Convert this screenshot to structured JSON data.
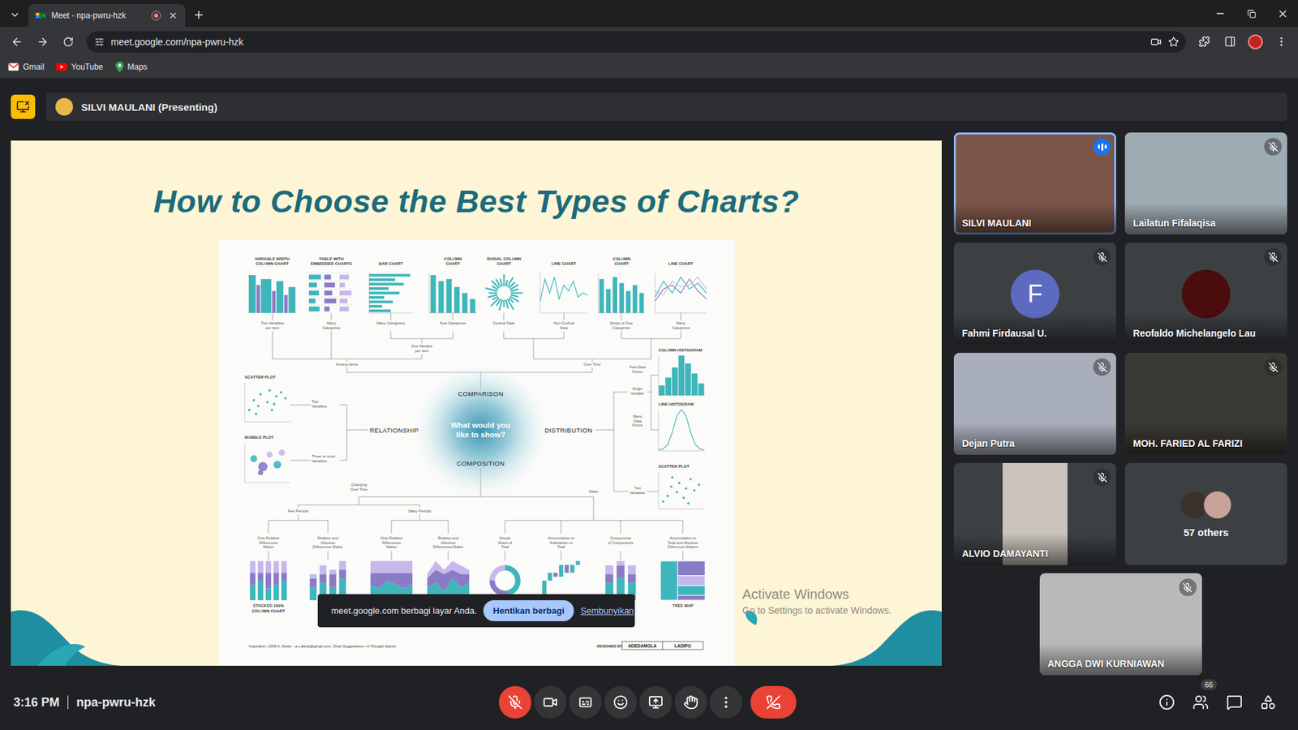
{
  "browser": {
    "tab": {
      "title": "Meet - npa-pwru-hzk",
      "selected": true,
      "recording": true
    },
    "address": "meet.google.com/npa-pwru-hzk",
    "bookmarks": [
      {
        "label": "Gmail",
        "kind": "mail",
        "color": "#ea4335"
      },
      {
        "label": "YouTube",
        "kind": "video",
        "color": "#ff0000"
      },
      {
        "label": "Maps",
        "kind": "map",
        "color": "#34a853"
      }
    ]
  },
  "presenting_bar": {
    "label": "SILVI MAULANI (Presenting)",
    "avatar_color": "#e8b84a"
  },
  "slide": {
    "title": "How to Choose the Best Types of Charts?",
    "question": [
      "What would you",
      "like to show?"
    ],
    "categories": [
      {
        "label": "COMPARISON"
      },
      {
        "label": "RELATIONSHIP"
      },
      {
        "label": "DISTRIBUTION"
      },
      {
        "label": "COMPOSITION"
      }
    ],
    "charts": [
      {
        "label": [
          "VARIABLE WIDTH",
          "COLUMN CHART"
        ],
        "kind": "varwidth",
        "series": [
          [
            0.95,
            0.7,
            0.85,
            0.55,
            0.8,
            0.45,
            0.65
          ],
          [
            2,
            1,
            3,
            1,
            2,
            1,
            2
          ]
        ]
      },
      {
        "label": [
          "TABLE WITH",
          "EMBEDDED CHARTS"
        ],
        "kind": "table",
        "series": [
          [
            0.9,
            0.5,
            0.7
          ],
          [
            0.6,
            0.8,
            0.4
          ],
          [
            0.75,
            0.6,
            0.9
          ],
          [
            0.5,
            0.9,
            0.6
          ],
          [
            0.8,
            0.4,
            0.7
          ]
        ]
      },
      {
        "label": [
          "BAR CHART"
        ],
        "kind": "bars",
        "series": [
          [
            0.95,
            0.6,
            0.8,
            0.45,
            0.7,
            0.35,
            0.55,
            0.3,
            0.5
          ]
        ]
      },
      {
        "label": [
          "COLUMN",
          "CHART"
        ],
        "kind": "columns",
        "series": [
          [
            0.95,
            0.8,
            0.85,
            0.65,
            0.5,
            0.35
          ]
        ]
      },
      {
        "label": [
          "RADIAL COLUMN",
          "CHART"
        ],
        "kind": "radial",
        "series": [
          [
            0.9,
            0.6,
            0.8,
            0.5,
            0.95,
            0.7,
            0.55,
            0.85,
            0.6,
            0.9,
            0.5,
            0.75,
            0.65,
            0.95,
            0.55,
            0.8,
            0.7,
            0.6,
            0.9,
            0.5,
            0.85,
            0.65,
            0.75,
            0.6
          ]
        ]
      },
      {
        "label": [
          "LINE CHART"
        ],
        "kind": "line",
        "series": [
          [
            0.3,
            0.85,
            0.5,
            0.9,
            0.35,
            0.7,
            0.55,
            0.8,
            0.4,
            0.5,
            0.45
          ]
        ]
      },
      {
        "label": [
          "COLUMN",
          "CHART"
        ],
        "kind": "columns",
        "series": [
          [
            0.85,
            0.6,
            0.9,
            0.75,
            0.55,
            0.7,
            0.5
          ]
        ]
      },
      {
        "label": [
          "LINE CHART"
        ],
        "kind": "line",
        "series": [
          [
            0.4,
            0.8,
            0.5,
            0.9,
            0.6,
            0.75,
            0.5
          ],
          [
            0.3,
            0.6,
            0.7,
            0.5,
            0.85,
            0.55,
            0.35
          ],
          [
            0.55,
            0.45,
            0.8,
            0.65,
            0.7,
            0.9,
            0.6
          ]
        ]
      },
      {
        "label": [
          "SCATTER PLOT"
        ],
        "kind": "scatter",
        "series": [
          [
            0.1,
            0.2,
            0.3,
            0.35,
            0.5,
            0.55,
            0.65,
            0.7,
            0.8,
            0.9,
            0.25,
            0.6
          ],
          [
            0.3,
            0.55,
            0.4,
            0.7,
            0.5,
            0.8,
            0.45,
            0.65,
            0.75,
            0.6,
            0.2,
            0.3
          ]
        ]
      },
      {
        "label": [
          "BUBBLE PLOT"
        ],
        "kind": "bubble",
        "series": [
          [
            0.2,
            0.4,
            0.55,
            0.72,
            0.35,
            0.82
          ],
          [
            0.6,
            0.4,
            0.7,
            0.45,
            0.25,
            0.75
          ],
          [
            0.5,
            0.8,
            0.4,
            0.6,
            0.3,
            0.45
          ]
        ]
      },
      {
        "label": [
          "COLUMN HISTOGRAM"
        ],
        "kind": "histogram",
        "series": [
          [
            0.25,
            0.45,
            0.7,
            1,
            0.8,
            0.55,
            0.3
          ]
        ]
      },
      {
        "label": [
          "LINE HISTOGRAM"
        ],
        "kind": "line",
        "series": [
          [
            0.02,
            0.05,
            0.15,
            0.45,
            0.85,
            1,
            0.85,
            0.45,
            0.15,
            0.05,
            0.02
          ]
        ]
      },
      {
        "label": [
          "SCATTER PLOT"
        ],
        "kind": "scatter",
        "series": [
          [
            0.1,
            0.2,
            0.28,
            0.4,
            0.45,
            0.55,
            0.6,
            0.7,
            0.78,
            0.88,
            0.3,
            0.65
          ],
          [
            0.2,
            0.35,
            0.6,
            0.45,
            0.7,
            0.3,
            0.55,
            0.8,
            0.5,
            0.65,
            0.85,
            0.15
          ]
        ]
      },
      {
        "label": [
          "STACKED 100%",
          "COLUMN CHART"
        ],
        "kind": "stacked100",
        "series": [
          [
            4,
            5,
            3,
            4,
            5
          ],
          [
            3,
            2,
            4,
            3,
            2
          ],
          [
            3,
            3,
            3,
            3,
            3
          ]
        ]
      },
      {
        "label": [],
        "kind": "stacked",
        "series": [
          [
            3,
            4,
            3,
            5
          ],
          [
            2,
            2,
            3,
            2
          ],
          [
            1,
            2,
            1,
            2
          ]
        ]
      },
      {
        "label": [],
        "kind": "area100",
        "series": [
          [
            4,
            3,
            5,
            4,
            3,
            4
          ],
          [
            3,
            4,
            2,
            3,
            4,
            3
          ],
          [
            3,
            3,
            3,
            3,
            3,
            3
          ]
        ]
      },
      {
        "label": [],
        "kind": "area",
        "series": [
          [
            3,
            4,
            2,
            5,
            3,
            4
          ],
          [
            2,
            3,
            4,
            2,
            3,
            2
          ],
          [
            1,
            2,
            1,
            2,
            2,
            1
          ]
        ]
      },
      {
        "label": [],
        "kind": "donut",
        "series": [
          [
            0.45,
            0.3,
            0.25
          ]
        ]
      },
      {
        "label": [],
        "kind": "waterfall",
        "series": [
          [
            5,
            2,
            -1,
            3,
            -2,
            2,
            1
          ]
        ]
      },
      {
        "label": [],
        "kind": "stacked",
        "series": [
          [
            4,
            5,
            4
          ],
          [
            2,
            3,
            2
          ],
          [
            2,
            1,
            2
          ]
        ]
      },
      {
        "label": [
          "TREE MAP"
        ],
        "kind": "treemap",
        "series": [
          [
            5,
            3,
            2,
            2,
            1
          ]
        ]
      }
    ],
    "notes": [
      [
        "Two Variables",
        "per Item"
      ],
      [
        "Many",
        "Categories"
      ],
      [
        "Many Categories"
      ],
      [
        "Few Categories"
      ],
      [
        "Cyclical Data"
      ],
      [
        "Non-Cyclical",
        "Data"
      ],
      [
        "Single or Few",
        "Categories"
      ],
      [
        "Many",
        "Categories"
      ],
      [
        "One Variable",
        "per Item"
      ],
      [
        "Among Items"
      ],
      [
        "Over Time"
      ],
      [
        "Two",
        "Variables"
      ],
      [
        "Three or more",
        "Variables"
      ],
      [
        "Few Data",
        "Points"
      ],
      [
        "Single",
        "Variable"
      ],
      [
        "Many",
        "Data",
        "Points"
      ],
      [
        "Two",
        "Variables"
      ],
      [
        "Changing",
        "Over Time"
      ],
      [
        "Static"
      ],
      [
        "Few Periods"
      ],
      [
        "Many Periods"
      ],
      [
        "Only Relative",
        "Differences",
        "Matter"
      ],
      [
        "Relative and",
        "Absolute",
        "Differences Matter"
      ],
      [
        "Only Relative",
        "Differences",
        "Matter"
      ],
      [
        "Relative and",
        "Absolute",
        "Differences Matter"
      ],
      [
        "Simple",
        "Share of",
        "Total"
      ],
      [
        "Accumulation or",
        "Subtraction to",
        "Total"
      ],
      [
        "Components",
        "of Components"
      ],
      [
        "Accumulation to",
        "Total and Absolute",
        "Difference Matters"
      ]
    ],
    "footer": {
      "credit": "Inspiration: 2009 A. Abela – a.v.abela@gmail.com. Chart Suggestions—A Thought-Starter.",
      "designed_by": "DESIGNED BY",
      "designer": [
        "ADEDAMOLA",
        "LADIPO"
      ]
    }
  },
  "share_notice": {
    "text": "meet.google.com berbagi layar Anda.",
    "stop": "Hentikan berbagi",
    "hide": "Sembunyikan"
  },
  "watermark": {
    "title": "Activate Windows",
    "subtitle": "Go to Settings to activate Windows."
  },
  "participants": [
    {
      "name": "SILVI MAULANI",
      "kind": "video",
      "color": "#7d5548",
      "muted": false,
      "speaking": true
    },
    {
      "name": "Lailatun Fifalaqisa",
      "kind": "video",
      "color": "#9eabb2",
      "muted": true,
      "speaking": false
    },
    {
      "name": "Fahmi Firdausal U.",
      "kind": "avatar",
      "initial": "F",
      "color": "#5c6bc0",
      "muted": true,
      "speaking": false
    },
    {
      "name": "Reofaldo Michelangelo Lau",
      "kind": "avatar",
      "initial": "",
      "color": "#4a0c0c",
      "muted": true,
      "speaking": false
    },
    {
      "name": "Dejan Putra",
      "kind": "video",
      "color": "#a9aebb",
      "muted": true,
      "speaking": false
    },
    {
      "name": "MOH. FARIED AL FARIZI",
      "kind": "video",
      "color": "#3b3934",
      "muted": true,
      "speaking": false
    },
    {
      "name": "ALVIO DAMAYANTI",
      "kind": "portrait",
      "color": "#c9c3bb",
      "muted": true,
      "speaking": false
    },
    {
      "name": "57 others",
      "kind": "others",
      "avatars": [
        "#3b302c",
        "#c7a39a"
      ]
    },
    {
      "name": "ANGGA DWI KURNIAWAN",
      "kind": "video",
      "color": "#b9b9b9",
      "muted": true,
      "speaking": false
    }
  ],
  "bottom_bar": {
    "time": "3:16 PM",
    "code": "npa-pwru-hzk",
    "controls": [
      {
        "kind": "mic",
        "alert": true
      },
      {
        "kind": "camera",
        "alert": false
      },
      {
        "kind": "captions",
        "alert": false
      },
      {
        "kind": "emoji",
        "alert": false
      },
      {
        "kind": "present",
        "alert": false
      },
      {
        "kind": "hand",
        "alert": false
      },
      {
        "kind": "more",
        "alert": false
      },
      {
        "kind": "leave",
        "alert": true
      }
    ],
    "panels": [
      {
        "kind": "info"
      },
      {
        "kind": "people",
        "badge": "66"
      },
      {
        "kind": "chat"
      },
      {
        "kind": "activities"
      }
    ]
  }
}
